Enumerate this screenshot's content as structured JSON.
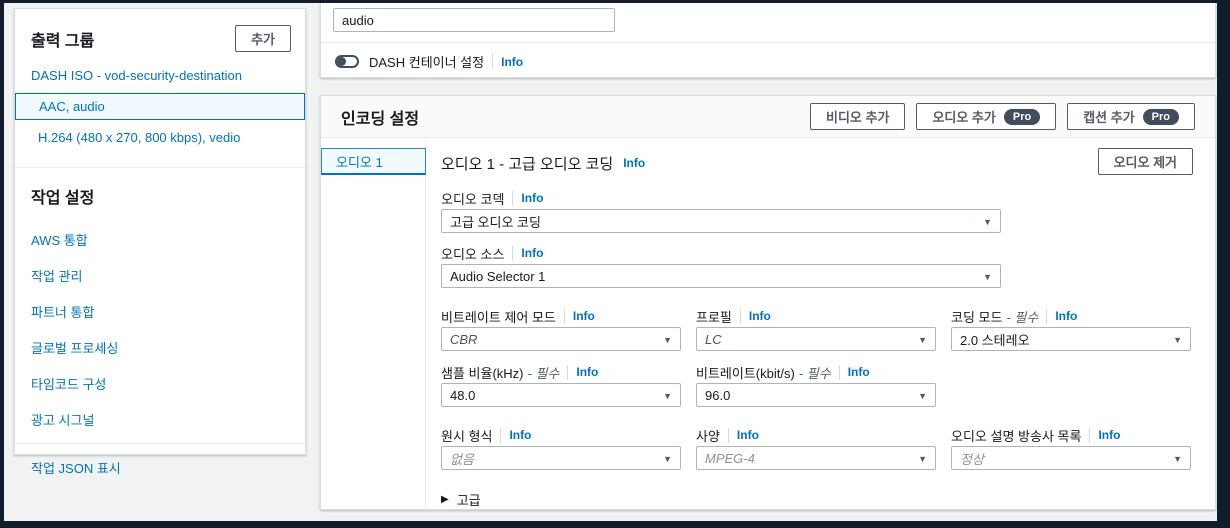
{
  "sidebar": {
    "output_groups": {
      "title": "출력 그룹",
      "add_button": "추가",
      "items": [
        {
          "label": "DASH ISO - vod-security-destination"
        },
        {
          "label": "AAC, audio"
        },
        {
          "label": "H.264 (480 x 270, 800 kbps), vedio"
        }
      ]
    },
    "job_settings": {
      "title": "작업 설정",
      "items": [
        {
          "label": "AWS 통합"
        },
        {
          "label": "작업 관리"
        },
        {
          "label": "파트너 통합"
        },
        {
          "label": "글로벌 프로세싱"
        },
        {
          "label": "타임코드 구성"
        },
        {
          "label": "광고 시그널"
        }
      ]
    },
    "show_json_link": "작업 JSON 표시"
  },
  "output_settings": {
    "name_modifier_value": "audio",
    "dash_container_toggle_label": "DASH 컨테이너 설정",
    "info_label": "Info"
  },
  "encoding": {
    "title": "인코딩 설정",
    "add_video_button": "비디오 추가",
    "add_audio_button": "오디오 추가",
    "add_caption_button": "캡션 추가",
    "pro_badge": "Pro",
    "tab_label": "오디오 1",
    "pane_title": "오디오 1 - 고급 오디오 코딩",
    "remove_audio_button": "오디오 제거",
    "info_label": "Info",
    "advanced_label": "고급",
    "fields": {
      "codec": {
        "label": "오디오 코덱",
        "value": "고급 오디오 코딩"
      },
      "source": {
        "label": "오디오 소스",
        "value": "Audio Selector 1"
      },
      "bitrate_control_mode": {
        "label": "비트레이트 제어 모드",
        "value": "CBR"
      },
      "profile": {
        "label": "프로필",
        "value": "LC"
      },
      "coding_mode": {
        "label": "코딩 모드",
        "required": "- 필수",
        "value": "2.0 스테레오"
      },
      "sample_rate": {
        "label": "샘플 비율(kHz)",
        "required": "- 필수",
        "value": "48.0"
      },
      "bitrate": {
        "label": "비트레이트(kbit/s)",
        "required": "- 필수",
        "value": "96.0"
      },
      "raw_format": {
        "label": "원시 형식",
        "value": "없음"
      },
      "specification": {
        "label": "사양",
        "value": "MPEG-4"
      },
      "audio_description_broadcaster_mix": {
        "label": "오디오 설명 방송사 목록",
        "value": "정상"
      }
    }
  },
  "colors": {
    "link_blue": "#0073bb",
    "selected_bg": "#f1faff",
    "frame_dark": "#121c2b",
    "badge_dark": "#414d5c"
  }
}
